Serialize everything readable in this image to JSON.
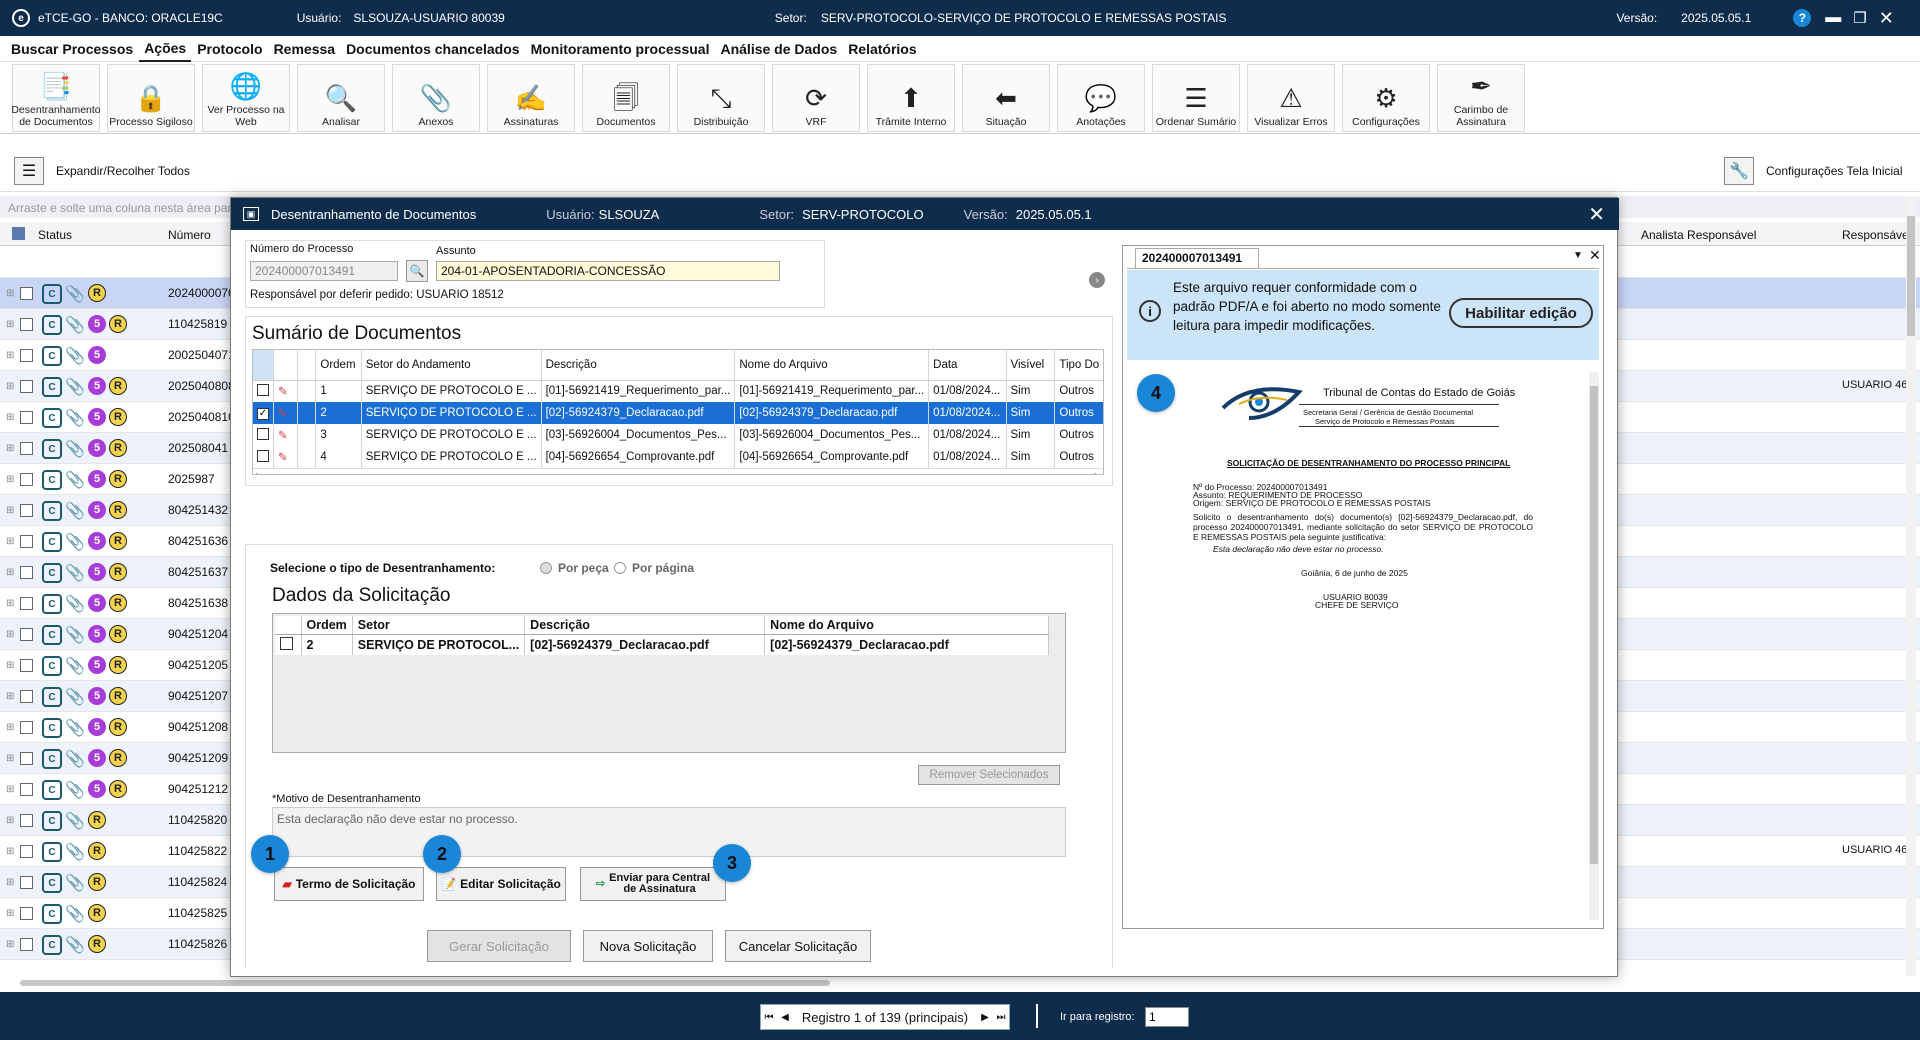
{
  "titlebar": {
    "app": "eTCE-GO - BANCO: ORACLE19C",
    "user_label": "Usuário:",
    "user": "SLSOUZA-USUARIO 80039",
    "sector_label": "Setor:",
    "sector": "SERV-PROTOCOLO-SERVIÇO DE PROTOCOLO E REMESSAS POSTAIS",
    "version_label": "Versão:",
    "version": "2025.05.05.1",
    "help": "?"
  },
  "menu": [
    "Buscar Processos",
    "Ações",
    "Protocolo",
    "Remessa",
    "Documentos chancelados",
    "Monitoramento processual",
    "Análise de Dados",
    "Relatórios"
  ],
  "ribbon": [
    {
      "label": "Desentranhamento de Documentos",
      "icon": "clip-docs-icon",
      "glyph": "📑"
    },
    {
      "label": "Processo Sigiloso",
      "icon": "lock-folder-icon",
      "glyph": "🔒"
    },
    {
      "label": "Ver Processo na Web",
      "icon": "web-doc-icon",
      "glyph": "🌐"
    },
    {
      "label": "Analisar",
      "icon": "analyze-icon",
      "glyph": "🔍"
    },
    {
      "label": "Anexos",
      "icon": "paperclip-icon",
      "glyph": "📎"
    },
    {
      "label": "Assinaturas",
      "icon": "signature-icon",
      "glyph": "✍"
    },
    {
      "label": "Documentos",
      "icon": "documents-icon",
      "glyph": "🗐"
    },
    {
      "label": "Distribuição",
      "icon": "distribution-icon",
      "glyph": "⤡"
    },
    {
      "label": "VRF",
      "icon": "refresh-dollar-icon",
      "glyph": "⟳"
    },
    {
      "label": "Trâmite Interno",
      "icon": "arrow-up-icon",
      "glyph": "⬆"
    },
    {
      "label": "Situação",
      "icon": "status-arrow-icon",
      "glyph": "⬅"
    },
    {
      "label": "Anotações",
      "icon": "speech-bubble-icon",
      "glyph": "💬"
    },
    {
      "label": "Ordenar Sumário",
      "icon": "ordered-list-icon",
      "glyph": "☰"
    },
    {
      "label": "Visualizar Erros",
      "icon": "error-doc-icon",
      "glyph": "⚠"
    },
    {
      "label": "Configurações",
      "icon": "gear-icon",
      "glyph": "⚙"
    },
    {
      "label": "Carimbo de Assinatura",
      "icon": "stamp-pen-icon",
      "glyph": "✒"
    }
  ],
  "subbar": {
    "expand": "Expandir/Recolher Todos",
    "config": "Configurações Tela Inicial"
  },
  "grid": {
    "hint": "Arraste e solte uma coluna nesta área para ag",
    "col_status": "Status",
    "col_numero": "Número",
    "col_analista": "Analista Responsável",
    "col_resp": "Responsáve",
    "rows": [
      {
        "num": "2024000070",
        "n": "",
        "r": true,
        "sel": true,
        "resp": ""
      },
      {
        "num": "110425819",
        "n": "5",
        "r": true,
        "resp": ""
      },
      {
        "num": "2002504071",
        "n": "5",
        "r": false,
        "resp": ""
      },
      {
        "num": "2025040808",
        "n": "5",
        "r": true,
        "resp": "USUARIO 46"
      },
      {
        "num": "2025040810",
        "n": "5",
        "r": true,
        "resp": ""
      },
      {
        "num": "202508041",
        "n": "5",
        "r": true,
        "resp": ""
      },
      {
        "num": "2025987",
        "n": "5",
        "r": true,
        "resp": ""
      },
      {
        "num": "804251432",
        "n": "5",
        "r": true,
        "resp": ""
      },
      {
        "num": "804251636",
        "n": "5",
        "r": true,
        "resp": ""
      },
      {
        "num": "804251637",
        "n": "5",
        "r": true,
        "resp": ""
      },
      {
        "num": "804251638",
        "n": "5",
        "r": true,
        "resp": ""
      },
      {
        "num": "904251204",
        "n": "5",
        "r": true,
        "resp": ""
      },
      {
        "num": "904251205",
        "n": "5",
        "r": true,
        "resp": ""
      },
      {
        "num": "904251207",
        "n": "5",
        "r": true,
        "resp": ""
      },
      {
        "num": "904251208",
        "n": "5",
        "r": true,
        "resp": ""
      },
      {
        "num": "904251209",
        "n": "5",
        "r": true,
        "resp": ""
      },
      {
        "num": "904251212",
        "n": "5",
        "r": true,
        "resp": ""
      },
      {
        "num": "110425820",
        "n": "",
        "r": true,
        "resp": ""
      },
      {
        "num": "110425822",
        "n": "",
        "r": true,
        "resp": "USUARIO 46"
      },
      {
        "num": "110425824",
        "n": "",
        "r": true,
        "resp": ""
      },
      {
        "num": "110425825",
        "n": "",
        "r": true,
        "resp": ""
      },
      {
        "num": "110425826",
        "n": "",
        "r": true,
        "resp": ""
      }
    ]
  },
  "pager": {
    "text": "Registro 1 of 139 (principais)",
    "goto": "Ir para registro:",
    "value": "1"
  },
  "modal": {
    "title": "Desentranhamento de Documentos",
    "user_label": "Usuário:",
    "user": "SLSOUZA",
    "sector_label": "Setor:",
    "sector": "SERV-PROTOCOLO",
    "version_label": "Versão:",
    "version": "2025.05.05.1",
    "numero_label": "Número do Processo",
    "numero": "202400007013491",
    "assunto_label": "Assunto",
    "assunto": "204-01-APOSENTADORIA-CONCESSÃO",
    "responsavel": "Responsável por deferir pedido: USUARIO 18512",
    "sumario_title": "Sumário de Documentos",
    "sum_cols": [
      "Ordem",
      "Setor do Andamento",
      "Descrição",
      "Nome do Arquivo",
      "Data",
      "Visível",
      "Tipo Do"
    ],
    "sum_rows": [
      {
        "ordem": "1",
        "setor": "SERVIÇO DE PROTOCOLO E ...",
        "desc": "[01]-56921419_Requerimento_par...",
        "arq": "[01]-56921419_Requerimento_par...",
        "data": "01/08/2024...",
        "vis": "Sim",
        "tipo": "Outros",
        "checked": false,
        "sel": false
      },
      {
        "ordem": "2",
        "setor": "SERVIÇO DE PROTOCOLO E ...",
        "desc": "[02]-56924379_Declaracao.pdf",
        "arq": "[02]-56924379_Declaracao.pdf",
        "data": "01/08/2024...",
        "vis": "Sim",
        "tipo": "Outros",
        "checked": true,
        "sel": true
      },
      {
        "ordem": "3",
        "setor": "SERVIÇO DE PROTOCOLO E ...",
        "desc": "[03]-56926004_Documentos_Pes...",
        "arq": "[03]-56926004_Documentos_Pes...",
        "data": "01/08/2024...",
        "vis": "Sim",
        "tipo": "Outros",
        "checked": false,
        "sel": false
      },
      {
        "ordem": "4",
        "setor": "SERVIÇO DE PROTOCOLO E ...",
        "desc": "[04]-56926654_Comprovante.pdf",
        "arq": "[04]-56926654_Comprovante.pdf",
        "data": "01/08/2024...",
        "vis": "Sim",
        "tipo": "Outros",
        "checked": false,
        "sel": false
      }
    ],
    "tipo_label": "Selecione o tipo de Desentranhamento:",
    "opt_peca": "Por peça",
    "opt_pagina": "Por página",
    "dados_title": "Dados da Solicitação",
    "dados_cols": [
      "Ordem",
      "Setor",
      "Descrição",
      "Nome do Arquivo"
    ],
    "dados_row": {
      "ordem": "2",
      "setor": "SERVIÇO DE PROTOCOL...",
      "desc": "[02]-56924379_Declaracao.pdf",
      "arq": "[02]-56924379_Declaracao.pdf"
    },
    "remover": "Remover Selecionados",
    "motivo_label": "*Motivo de Desentranhamento",
    "motivo": "Esta declaração não deve estar no processo.",
    "btn_termo": "Termo de Solicitação",
    "btn_editar": "Editar Solicitação",
    "btn_enviar1": "Enviar para Central",
    "btn_enviar2": "de Assinatura",
    "btn_gerar": "Gerar Solicitação",
    "btn_nova": "Nova Solicitação",
    "btn_cancelar": "Cancelar Solicitação",
    "badges": [
      "1",
      "2",
      "3",
      "4"
    ]
  },
  "pdf": {
    "tab": "202400007013491",
    "banner": "Este arquivo requer conformidade com o padrão PDF/A e foi aberto no modo somente leitura para impedir modificações.",
    "habilitar": "Habilitar edição",
    "org": "Tribunal de Contas do Estado de Goiás",
    "sub1": "Secretaria Geral / Gerência de Gestão Documental",
    "sub2": "Serviço de Protocolo e Remessas Postais",
    "heading": "SOLICITAÇÃO DE DESENTRANHAMENTO DO PROCESSO PRINCIPAL",
    "l1": "Nº do Processo: 202400007013491",
    "l2": "Assunto: REQUERIMENTO DE PROCESSO",
    "l3": "Origem: SERVIÇO DE PROTOCOLO E REMESSAS POSTAIS",
    "body": "Solicito o desentranhamento do(s) documento(s) [02]-56924379_Declaracao.pdf, do processo 202400007013491, mediante solicitação do setor SERVIÇO DE PROTOCOLO E REMESSAS POSTAIS pela seguinte justificativa:",
    "just": "Esta declaração não deve estar no processo.",
    "date": "Goiânia, 6 de junho de 2025",
    "sig1": "USUARIO 80039",
    "sig2": "CHEFE DE SERVIÇO"
  }
}
